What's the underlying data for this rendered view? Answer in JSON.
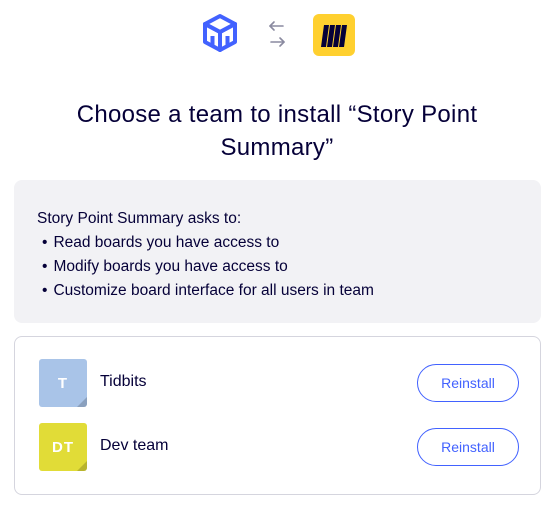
{
  "header": {
    "app_icon": "box-icon",
    "swap_icon": "swap-arrows-icon",
    "miro_icon": "miro-logo-icon",
    "title": "Choose a team to install “Story Point Summary”"
  },
  "permissions": {
    "intro": "Story Point Summary asks to:",
    "items": [
      "Read boards you have access to",
      "Modify boards you have access to",
      "Customize board interface for all users in team"
    ]
  },
  "teams": [
    {
      "initials": "T",
      "name": "Tidbits",
      "color": "#a9c4e8",
      "button_label": "Reinstall"
    },
    {
      "initials": "DT",
      "name": "Dev team",
      "color": "#e1dc37",
      "button_label": "Reinstall"
    }
  ],
  "colors": {
    "accent": "#4262ff",
    "miro_yellow": "#ffd02f",
    "text": "#050038"
  }
}
